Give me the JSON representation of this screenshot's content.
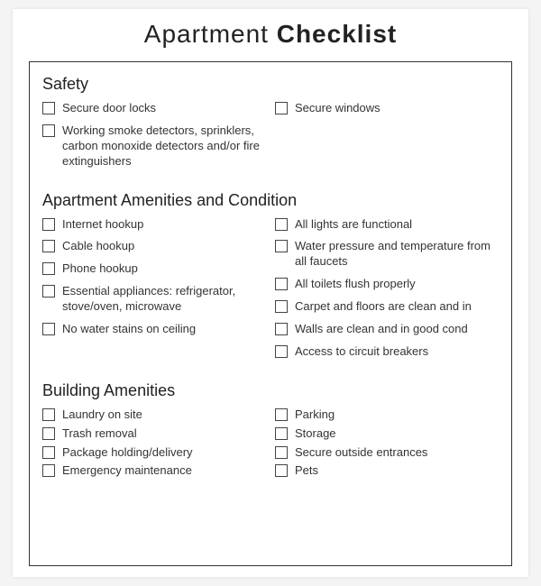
{
  "title_part1": "Apartment",
  "title_part2": "Checklist",
  "sections": {
    "safety": {
      "title": "Safety",
      "left": [
        "Secure door locks",
        "Working smoke detectors, sprinklers, carbon monoxide detectors and/or fire extinguishers"
      ],
      "right": [
        "Secure windows"
      ]
    },
    "amenities": {
      "title": "Apartment Amenities and Condition",
      "left": [
        "Internet hookup",
        "Cable hookup",
        "Phone hookup",
        "Essential appliances: refrigerator, stove/oven, microwave",
        "No water stains on ceiling"
      ],
      "right": [
        "All lights are functional",
        "Water pressure and temperature from all faucets",
        "All toilets flush properly",
        "Carpet and floors are clean and in",
        "Walls are clean and in good cond",
        "Access to circuit breakers"
      ]
    },
    "building": {
      "title": "Building Amenities",
      "left": [
        "Laundry on site",
        "Trash removal",
        "Package holding/delivery",
        "Emergency maintenance"
      ],
      "right": [
        "Parking",
        "Storage",
        "Secure outside entrances",
        "Pets"
      ]
    }
  }
}
